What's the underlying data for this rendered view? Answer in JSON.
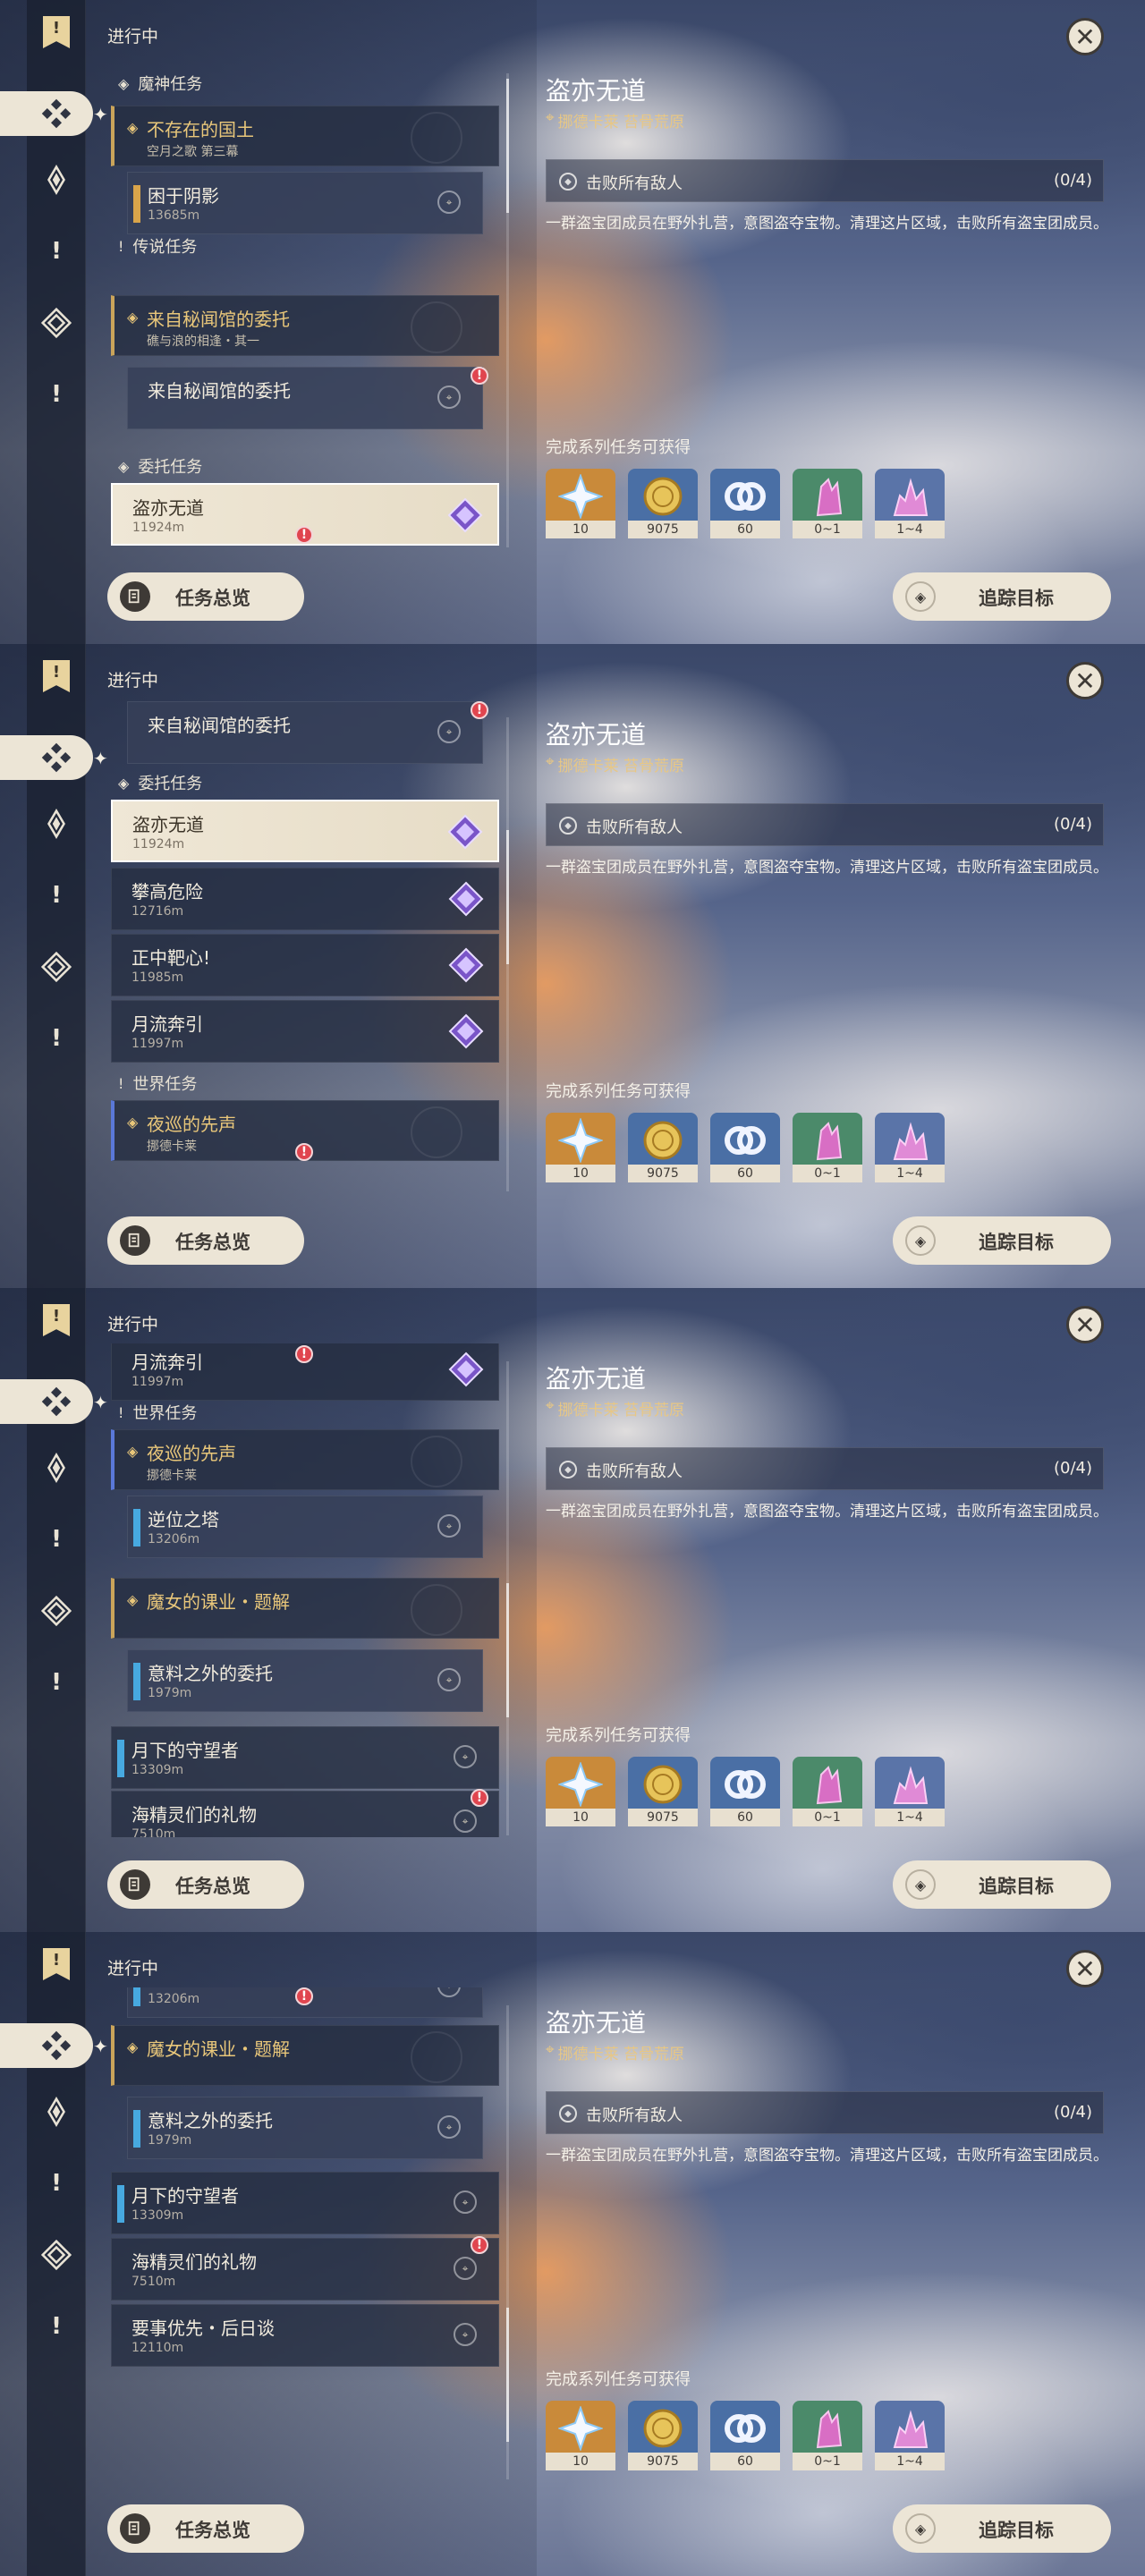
{
  "header": {
    "in_progress": "进行中"
  },
  "rail": {
    "bookmark": "!"
  },
  "groups": {
    "archon": "魔神任务",
    "legend": "传说任务",
    "commission": "委托任务",
    "world": "世界任务"
  },
  "quests": {
    "archon": {
      "title": "不存在的国土",
      "sub": "空月之歌 第三幕"
    },
    "shadow": {
      "title": "困于阴影",
      "dist": "13685m"
    },
    "legend": {
      "title": "来自秘闻馆的委托",
      "sub": "礁与浪的相逢・其一"
    },
    "legend_sub": {
      "title": "来自秘闻馆的委托"
    },
    "c1": {
      "title": "盗亦无道",
      "dist": "11924m"
    },
    "c2": {
      "title": "攀高危险",
      "dist": "12716m"
    },
    "c3": {
      "title": "正中靶心!",
      "dist": "11985m"
    },
    "c4": {
      "title": "月流奔引",
      "dist": "11997m"
    },
    "w1": {
      "title": "夜巡的先声",
      "sub": "挪德卡莱"
    },
    "w1s": {
      "title": "逆位之塔",
      "dist": "13206m"
    },
    "w2": {
      "title": "魔女的课业・题解"
    },
    "w2s": {
      "title": "意料之外的委托",
      "dist": "1979m"
    },
    "w3": {
      "title": "月下的守望者",
      "dist": "13309m"
    },
    "w4": {
      "title": "海精灵们的礼物",
      "dist": "7510m"
    },
    "w5": {
      "title": "要事优先・后日谈",
      "dist": "12110m"
    }
  },
  "buttons": {
    "overview": "任务总览",
    "track": "追踪目标",
    "close": "✕"
  },
  "detail": {
    "title": "盗亦无道",
    "location": "挪德卡莱 苔骨荒原",
    "objective": "击败所有敌人",
    "count": "(0/4)",
    "description": "一群盗宝团成员在野外扎营，意图盗夺宝物。清理这片区域，击败所有盗宝团成员。",
    "rewards_heading": "完成系列任务可获得",
    "rewards": [
      {
        "icon": "primogem-icon",
        "amount": "10",
        "color": "#c98a3a"
      },
      {
        "icon": "mora-icon",
        "amount": "9075",
        "color": "#4a6fa5"
      },
      {
        "icon": "companionship-exp-icon",
        "amount": "60",
        "color": "#4a6fa5"
      },
      {
        "icon": "crystal-material-icon",
        "amount": "0~1",
        "color": "#4b8a6a"
      },
      {
        "icon": "crystal-chunk-icon",
        "amount": "1~4",
        "color": "#5a74a8"
      }
    ]
  }
}
